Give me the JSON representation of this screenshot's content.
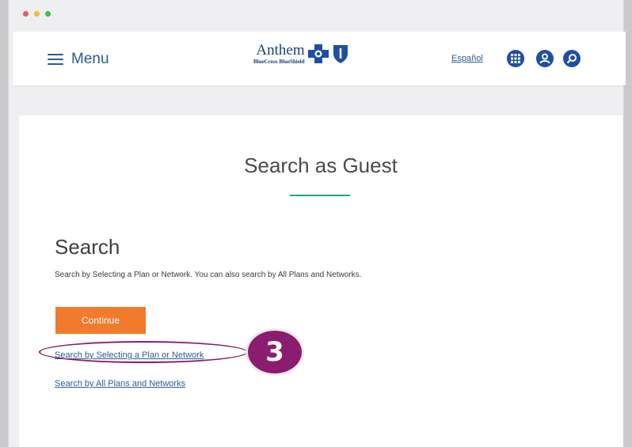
{
  "header": {
    "menu_label": "Menu",
    "logo": {
      "name": "Anthem",
      "sub": "BlueCross BlueShield"
    },
    "lang_link": "Español",
    "icons": [
      "grid-icon",
      "user-icon",
      "search-icon"
    ]
  },
  "page": {
    "title": "Search as Guest"
  },
  "search": {
    "heading": "Search",
    "description": "Search by Selecting a Plan or Network. You can also search by All Plans and Networks.",
    "continue_label": "Continue",
    "link_plan": "Search by Selecting a Plan or Network",
    "link_all": "Search by All Plans and Networks"
  },
  "annotation": {
    "step": "3"
  },
  "colors": {
    "brand_blue": "#1e4fa3",
    "link_blue": "#2a5d98",
    "accent_teal": "#1aa3a0",
    "button_orange": "#f07b2c",
    "annotation_purple": "#8a1d6e"
  }
}
